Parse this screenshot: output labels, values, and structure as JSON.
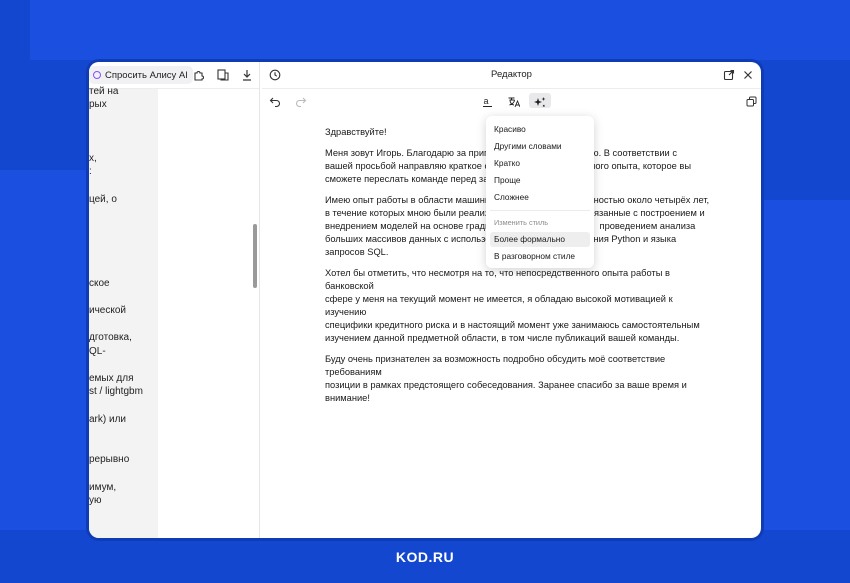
{
  "left_panel": {
    "ask_alice_label": "Спросить Алису AI",
    "text_lines": [
      "тей на",
      "рых",
      "х,",
      ":",
      "цей, о",
      "ское",
      "ической",
      "дготовка,",
      "QL-",
      "емых для",
      "st / lightgbm",
      "ark) или",
      "рерывно",
      "имум,",
      "ую"
    ]
  },
  "editor": {
    "title": "Редактор",
    "paragraphs": [
      "Здравствуйте!",
      "Меня зовут Игорь. Благодарю за пригла",
      "вью. В соответствии с",
      "вашей просьбой направляю краткое опи",
      "льного опыта, которое вы",
      "сможете переслать команде перед завт",
      "Имею опыт работы в области машинног",
      "ностью около четырёх лет,",
      "в течение которых мною были реализо",
      "вязанные с построением и",
      "внедрением моделей на основе градиен",
      "проведением анализа",
      "больших массивов данных с использова",
      "вания Python и языка",
      "запросов SQL.",
      "Хотел бы отметить, что несмотря на то, что непосредственного опыта работы в банковской",
      "сфере у меня на текущий момент не имеется, я обладаю высокой мотивацией к изучению",
      "специфики кредитного риска и в настоящий момент уже занимаюсь самостоятельным",
      "изучением данной предметной области, в том числе публикаций вашей команды.",
      "Буду очень признателен за возможность подробно обсудить моё соответствие требованиям",
      "позиции в рамках предстоящего собеседования. Заранее спасибо за ваше время и",
      "внимание!"
    ]
  },
  "menu": {
    "items": [
      "Красиво",
      "Другими словами",
      "Кратко",
      "Проще",
      "Сложнее"
    ],
    "section_label": "Изменить стиль",
    "style_items": [
      "Более формально",
      "В разговорном стиле"
    ]
  },
  "footer": {
    "brand": "KOD.RU"
  },
  "colors": {
    "background": "#1447d0",
    "alice_accent": "#8a4dff"
  }
}
